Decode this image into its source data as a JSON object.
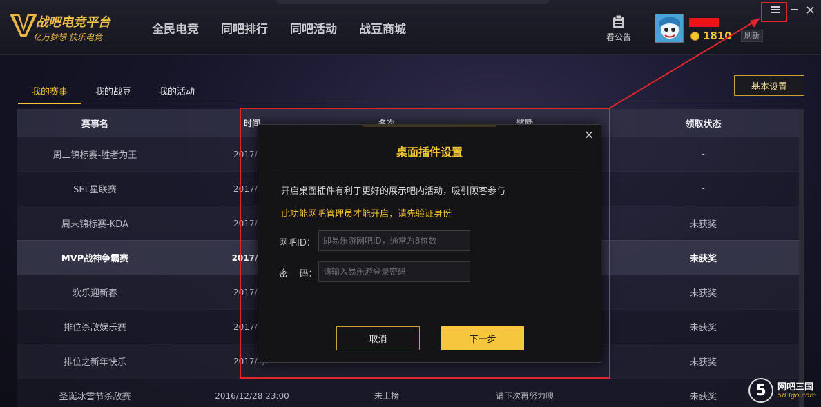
{
  "header": {
    "logo_title": "战吧电竞平台",
    "logo_slogan": "亿万梦想  快乐电竞",
    "nav": [
      "全民电竞",
      "同吧排行",
      "同吧活动",
      "战豆商城"
    ],
    "notice_label": "看公告",
    "coins": "1810",
    "refresh_label": "刷新",
    "window_controls": [
      "menu-icon",
      "minimize-icon",
      "close-icon"
    ]
  },
  "tabs": [
    "我的赛事",
    "我的战豆",
    "我的活动"
  ],
  "active_tab": "我的赛事",
  "basic_settings_label": "基本设置",
  "table": {
    "columns": [
      "赛事名",
      "时间",
      "名次",
      "奖励",
      "领取状态"
    ],
    "rows": [
      {
        "name": "周二锦标赛-胜者为王",
        "time": "2017/4/1",
        "rank": "",
        "reward": "",
        "status": "-"
      },
      {
        "name": "SEL星联赛",
        "time": "2017/4/1",
        "rank": "",
        "reward": "",
        "status": "-"
      },
      {
        "name": "周末锦标赛-KDA",
        "time": "2017/4/1",
        "rank": "",
        "reward": "",
        "status": "未获奖"
      },
      {
        "name": "MVP战神争霸赛",
        "time": "2017/4/4",
        "rank": "",
        "reward": "",
        "status": "未获奖"
      },
      {
        "name": "欢乐迎新春",
        "time": "2017/1/2",
        "rank": "",
        "reward": "",
        "status": "未获奖"
      },
      {
        "name": "排位杀敌娱乐赛",
        "time": "2017/1/2",
        "rank": "",
        "reward": "",
        "status": "未获奖"
      },
      {
        "name": "排位之新年快乐",
        "time": "2017/1/2",
        "rank": "",
        "reward": "",
        "status": "未获奖"
      },
      {
        "name": "圣诞冰雪节杀敌赛",
        "time": "2016/12/28 23:00",
        "rank": "未上榜",
        "reward": "请下次再努力噢",
        "status": "未获奖"
      }
    ]
  },
  "modal": {
    "title": "桌面插件设置",
    "description": "开启桌面插件有利于更好的展示吧内活动，吸引顾客参与",
    "warning": "此功能网吧管理员才能开启，请先验证身份",
    "id_label": "网吧ID：",
    "id_placeholder": "即易乐游网吧ID，通常为8位数",
    "password_label": "密    码：",
    "password_placeholder": "请输入易乐游登录密码",
    "cancel_label": "取消",
    "next_label": "下一步"
  },
  "watermark": {
    "badge": "5",
    "name": "网吧三国",
    "url": "583go.com"
  },
  "colors": {
    "accent": "#f3c433",
    "annotation_red": "#e0262b",
    "background": "#0f0f16"
  }
}
